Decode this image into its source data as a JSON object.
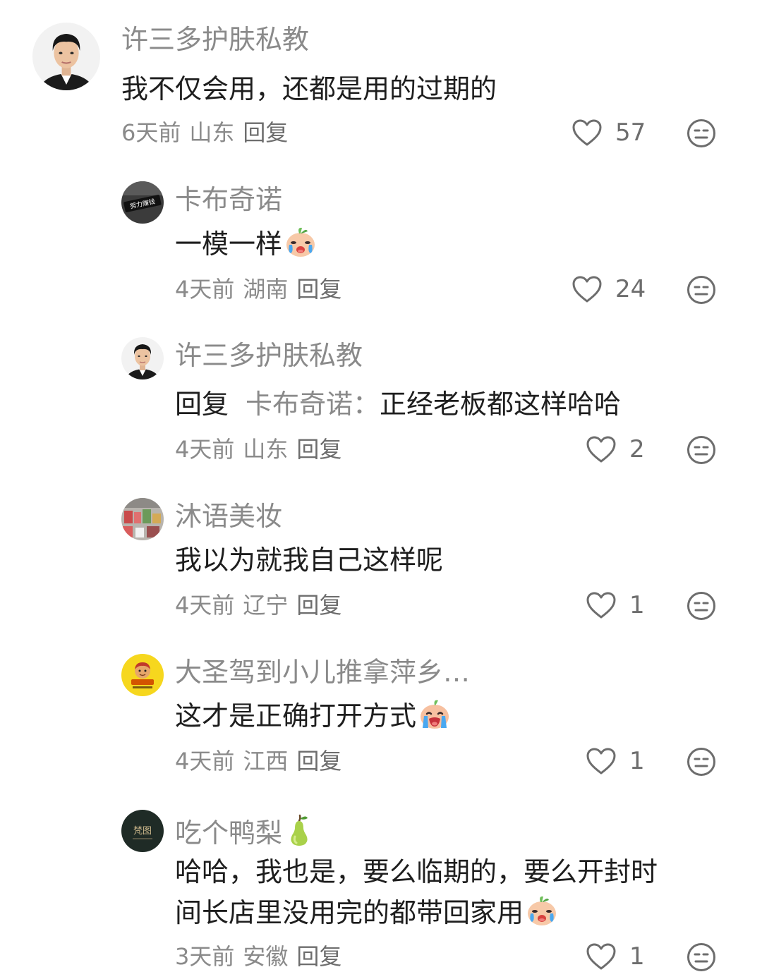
{
  "comments": [
    {
      "name": "许三多护肤私教",
      "text": "我不仅会用，还都是用的过期的",
      "time": "6天前",
      "location": "山东",
      "reply_label": "回复",
      "likes": "57"
    },
    {
      "name": "卡布奇诺",
      "avatar_text": "努力赚钱",
      "text": "一模一样",
      "emoji": "crying-face-emoji",
      "time": "4天前",
      "location": "湖南",
      "reply_label": "回复",
      "likes": "24"
    },
    {
      "name": "许三多护肤私教",
      "reply_prefix": "回复",
      "reply_target": "卡布奇诺：",
      "text": "正经老板都这样哈哈",
      "time": "4天前",
      "location": "山东",
      "reply_label": "回复",
      "likes": "2"
    },
    {
      "name": "沐语美妆",
      "text": "我以为就我自己这样呢",
      "time": "4天前",
      "location": "辽宁",
      "reply_label": "回复",
      "likes": "1"
    },
    {
      "name": "大圣驾到小儿推拿萍乡…",
      "text": "这才是正确打开方式",
      "emoji": "sobbing-face-emoji",
      "time": "4天前",
      "location": "江西",
      "reply_label": "回复",
      "likes": "1"
    },
    {
      "name": "吃个鸭梨",
      "name_icon": "pear-icon",
      "avatar_text": "梵图",
      "text_line1": "哈哈，我也是，要么临期的，要么开封时",
      "text_line2": "间长店里没用完的都带回家用",
      "emoji": "crying-face-emoji",
      "time": "3天前",
      "location": "安徽",
      "reply_label": "回复",
      "likes": "1"
    }
  ],
  "colors": {
    "name": "#8a8a8a",
    "text": "#1e1e1e",
    "meta": "#8a8a8a",
    "icon": "#6d6d6d"
  },
  "icons": {
    "like": "heart-outline-icon",
    "react": "neutral-face-icon"
  }
}
